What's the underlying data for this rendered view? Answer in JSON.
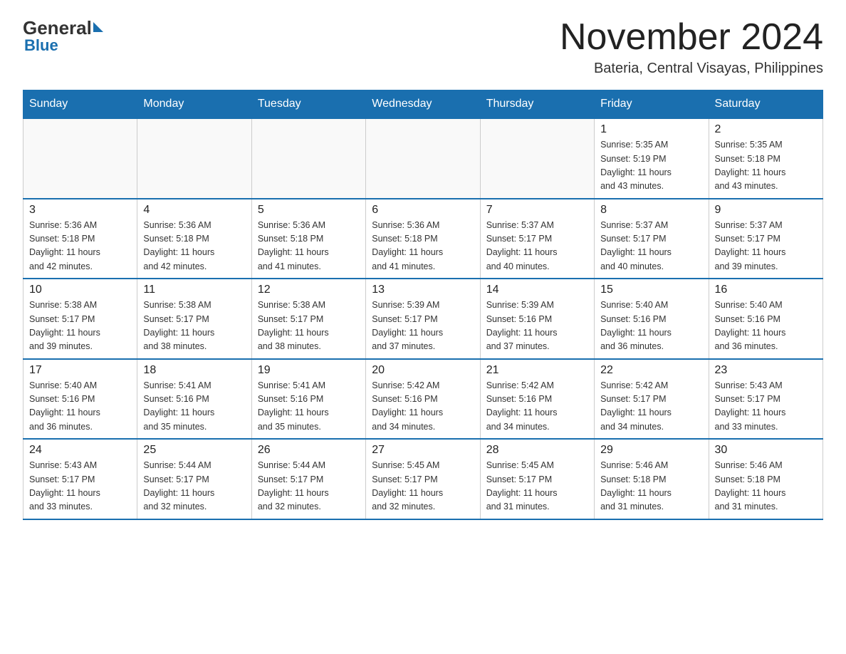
{
  "logo": {
    "general": "General",
    "triangle": "",
    "blue": "Blue"
  },
  "header": {
    "month_year": "November 2024",
    "location": "Bateria, Central Visayas, Philippines"
  },
  "weekdays": [
    "Sunday",
    "Monday",
    "Tuesday",
    "Wednesday",
    "Thursday",
    "Friday",
    "Saturday"
  ],
  "weeks": [
    [
      {
        "day": "",
        "info": ""
      },
      {
        "day": "",
        "info": ""
      },
      {
        "day": "",
        "info": ""
      },
      {
        "day": "",
        "info": ""
      },
      {
        "day": "",
        "info": ""
      },
      {
        "day": "1",
        "info": "Sunrise: 5:35 AM\nSunset: 5:19 PM\nDaylight: 11 hours\nand 43 minutes."
      },
      {
        "day": "2",
        "info": "Sunrise: 5:35 AM\nSunset: 5:18 PM\nDaylight: 11 hours\nand 43 minutes."
      }
    ],
    [
      {
        "day": "3",
        "info": "Sunrise: 5:36 AM\nSunset: 5:18 PM\nDaylight: 11 hours\nand 42 minutes."
      },
      {
        "day": "4",
        "info": "Sunrise: 5:36 AM\nSunset: 5:18 PM\nDaylight: 11 hours\nand 42 minutes."
      },
      {
        "day": "5",
        "info": "Sunrise: 5:36 AM\nSunset: 5:18 PM\nDaylight: 11 hours\nand 41 minutes."
      },
      {
        "day": "6",
        "info": "Sunrise: 5:36 AM\nSunset: 5:18 PM\nDaylight: 11 hours\nand 41 minutes."
      },
      {
        "day": "7",
        "info": "Sunrise: 5:37 AM\nSunset: 5:17 PM\nDaylight: 11 hours\nand 40 minutes."
      },
      {
        "day": "8",
        "info": "Sunrise: 5:37 AM\nSunset: 5:17 PM\nDaylight: 11 hours\nand 40 minutes."
      },
      {
        "day": "9",
        "info": "Sunrise: 5:37 AM\nSunset: 5:17 PM\nDaylight: 11 hours\nand 39 minutes."
      }
    ],
    [
      {
        "day": "10",
        "info": "Sunrise: 5:38 AM\nSunset: 5:17 PM\nDaylight: 11 hours\nand 39 minutes."
      },
      {
        "day": "11",
        "info": "Sunrise: 5:38 AM\nSunset: 5:17 PM\nDaylight: 11 hours\nand 38 minutes."
      },
      {
        "day": "12",
        "info": "Sunrise: 5:38 AM\nSunset: 5:17 PM\nDaylight: 11 hours\nand 38 minutes."
      },
      {
        "day": "13",
        "info": "Sunrise: 5:39 AM\nSunset: 5:17 PM\nDaylight: 11 hours\nand 37 minutes."
      },
      {
        "day": "14",
        "info": "Sunrise: 5:39 AM\nSunset: 5:16 PM\nDaylight: 11 hours\nand 37 minutes."
      },
      {
        "day": "15",
        "info": "Sunrise: 5:40 AM\nSunset: 5:16 PM\nDaylight: 11 hours\nand 36 minutes."
      },
      {
        "day": "16",
        "info": "Sunrise: 5:40 AM\nSunset: 5:16 PM\nDaylight: 11 hours\nand 36 minutes."
      }
    ],
    [
      {
        "day": "17",
        "info": "Sunrise: 5:40 AM\nSunset: 5:16 PM\nDaylight: 11 hours\nand 36 minutes."
      },
      {
        "day": "18",
        "info": "Sunrise: 5:41 AM\nSunset: 5:16 PM\nDaylight: 11 hours\nand 35 minutes."
      },
      {
        "day": "19",
        "info": "Sunrise: 5:41 AM\nSunset: 5:16 PM\nDaylight: 11 hours\nand 35 minutes."
      },
      {
        "day": "20",
        "info": "Sunrise: 5:42 AM\nSunset: 5:16 PM\nDaylight: 11 hours\nand 34 minutes."
      },
      {
        "day": "21",
        "info": "Sunrise: 5:42 AM\nSunset: 5:16 PM\nDaylight: 11 hours\nand 34 minutes."
      },
      {
        "day": "22",
        "info": "Sunrise: 5:42 AM\nSunset: 5:17 PM\nDaylight: 11 hours\nand 34 minutes."
      },
      {
        "day": "23",
        "info": "Sunrise: 5:43 AM\nSunset: 5:17 PM\nDaylight: 11 hours\nand 33 minutes."
      }
    ],
    [
      {
        "day": "24",
        "info": "Sunrise: 5:43 AM\nSunset: 5:17 PM\nDaylight: 11 hours\nand 33 minutes."
      },
      {
        "day": "25",
        "info": "Sunrise: 5:44 AM\nSunset: 5:17 PM\nDaylight: 11 hours\nand 32 minutes."
      },
      {
        "day": "26",
        "info": "Sunrise: 5:44 AM\nSunset: 5:17 PM\nDaylight: 11 hours\nand 32 minutes."
      },
      {
        "day": "27",
        "info": "Sunrise: 5:45 AM\nSunset: 5:17 PM\nDaylight: 11 hours\nand 32 minutes."
      },
      {
        "day": "28",
        "info": "Sunrise: 5:45 AM\nSunset: 5:17 PM\nDaylight: 11 hours\nand 31 minutes."
      },
      {
        "day": "29",
        "info": "Sunrise: 5:46 AM\nSunset: 5:18 PM\nDaylight: 11 hours\nand 31 minutes."
      },
      {
        "day": "30",
        "info": "Sunrise: 5:46 AM\nSunset: 5:18 PM\nDaylight: 11 hours\nand 31 minutes."
      }
    ]
  ]
}
